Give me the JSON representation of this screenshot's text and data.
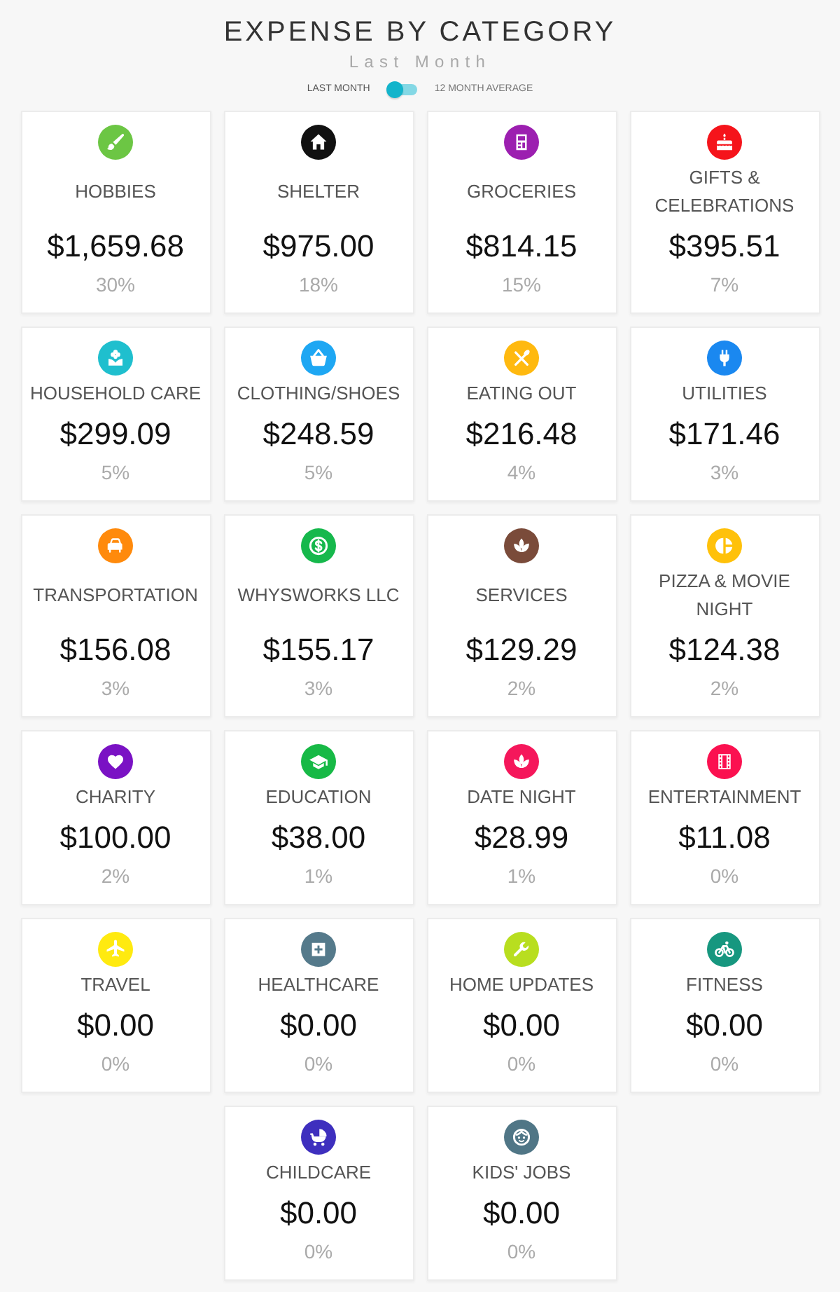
{
  "header": {
    "title": "EXPENSE BY CATEGORY",
    "subtitle": "Last Month"
  },
  "period_toggle": {
    "options": [
      {
        "label": "LAST MONTH",
        "selected": true
      },
      {
        "label": "12 MONTH AVERAGE",
        "selected": false
      }
    ]
  },
  "categories": [
    {
      "name": "HOBBIES",
      "amount": "$1,659.68",
      "percent": "30%",
      "color": "#6cc644"
    },
    {
      "name": "SHELTER",
      "amount": "$975.00",
      "percent": "18%",
      "color": "#111111"
    },
    {
      "name": "GROCERIES",
      "amount": "$814.15",
      "percent": "15%",
      "color": "#9c1fb0"
    },
    {
      "name": "GIFTS & CELEBRATIONS",
      "amount": "$395.51",
      "percent": "7%",
      "color": "#f5141b"
    },
    {
      "name": "HOUSEHOLD CARE",
      "amount": "$299.09",
      "percent": "5%",
      "color": "#1fbfce"
    },
    {
      "name": "CLOTHING/SHOES",
      "amount": "$248.59",
      "percent": "5%",
      "color": "#1ea7f3"
    },
    {
      "name": "EATING OUT",
      "amount": "$216.48",
      "percent": "4%",
      "color": "#ffb90f"
    },
    {
      "name": "UTILITIES",
      "amount": "$171.46",
      "percent": "3%",
      "color": "#1a88f0"
    },
    {
      "name": "TRANSPORTATION",
      "amount": "$156.08",
      "percent": "3%",
      "color": "#ff8a0c"
    },
    {
      "name": "WHYSWORKS LLC",
      "amount": "$155.17",
      "percent": "3%",
      "color": "#16b84c"
    },
    {
      "name": "SERVICES",
      "amount": "$129.29",
      "percent": "2%",
      "color": "#7a4b3a"
    },
    {
      "name": "PIZZA & MOVIE NIGHT",
      "amount": "$124.38",
      "percent": "2%",
      "color": "#ffc10a"
    },
    {
      "name": "CHARITY",
      "amount": "$100.00",
      "percent": "2%",
      "color": "#7a12c4"
    },
    {
      "name": "EDUCATION",
      "amount": "$38.00",
      "percent": "1%",
      "color": "#17b946"
    },
    {
      "name": "DATE NIGHT",
      "amount": "$28.99",
      "percent": "1%",
      "color": "#f5175b"
    },
    {
      "name": "ENTERTAINMENT",
      "amount": "$11.08",
      "percent": "0%",
      "color": "#fb1150"
    },
    {
      "name": "TRAVEL",
      "amount": "$0.00",
      "percent": "0%",
      "color": "#ffea10"
    },
    {
      "name": "HEALTHCARE",
      "amount": "$0.00",
      "percent": "0%",
      "color": "#557a8b"
    },
    {
      "name": "HOME UPDATES",
      "amount": "$0.00",
      "percent": "0%",
      "color": "#b8de1f"
    },
    {
      "name": "FITNESS",
      "amount": "$0.00",
      "percent": "0%",
      "color": "#17977f"
    },
    {
      "name": "CHILDCARE",
      "amount": "$0.00",
      "percent": "0%",
      "color": "#3e2fbe"
    },
    {
      "name": "KIDS' JOBS",
      "amount": "$0.00",
      "percent": "0%",
      "color": "#507686"
    }
  ]
}
